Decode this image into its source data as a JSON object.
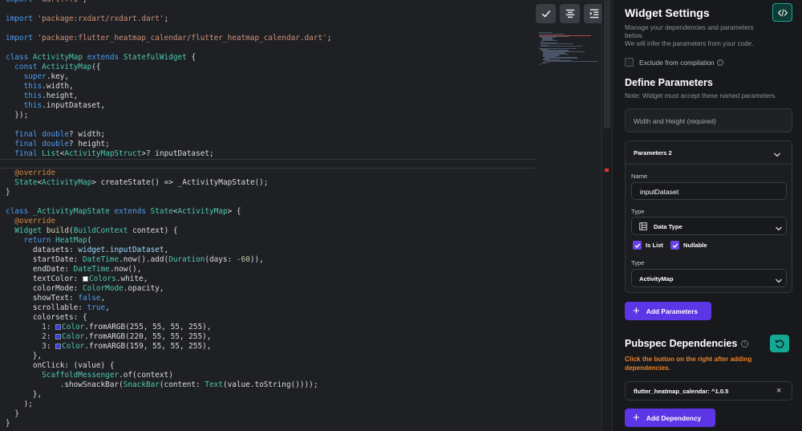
{
  "editor": {
    "lines": [
      [
        [
          "kw",
          "import "
        ],
        [
          "str",
          "'dart:ffi'"
        ],
        [
          "pl",
          ";"
        ]
      ],
      [],
      [
        [
          "kw",
          "import "
        ],
        [
          "str",
          "'package:rxdart/rxdart.dart'"
        ],
        [
          "pl",
          ";"
        ]
      ],
      [],
      [
        [
          "kw",
          "import "
        ],
        [
          "str",
          "'package:flutter_heatmap_calendar/flutter_heatmap_calendar.dart'"
        ],
        [
          "pl",
          ";"
        ]
      ],
      [],
      [
        [
          "kw",
          "class "
        ],
        [
          "ty",
          "ActivityMap "
        ],
        [
          "kw",
          "extends "
        ],
        [
          "ty",
          "StatefulWidget"
        ],
        [
          "pl",
          " {"
        ]
      ],
      [
        [
          "kw",
          "  const "
        ],
        [
          "ty",
          "ActivityMap"
        ],
        [
          "pl",
          "({"
        ]
      ],
      [
        [
          "kw",
          "    super"
        ],
        [
          "pl",
          ".key,"
        ]
      ],
      [
        [
          "kw",
          "    this"
        ],
        [
          "pl",
          ".width,"
        ]
      ],
      [
        [
          "kw",
          "    this"
        ],
        [
          "pl",
          ".height,"
        ]
      ],
      [
        [
          "kw",
          "    this"
        ],
        [
          "pl",
          ".inputDataset,"
        ]
      ],
      [
        [
          "pl",
          "  });"
        ]
      ],
      [],
      [
        [
          "kw",
          "  final "
        ],
        [
          "kw",
          "double"
        ],
        [
          "pl",
          "? width;"
        ]
      ],
      [
        [
          "kw",
          "  final "
        ],
        [
          "kw",
          "double"
        ],
        [
          "pl",
          "? height;"
        ]
      ],
      [
        [
          "kw",
          "  final "
        ],
        [
          "ty",
          "List"
        ],
        [
          "pl",
          "<"
        ],
        [
          "ty",
          "ActivityMapStruct"
        ],
        [
          "pl",
          ">? inputDataset;"
        ]
      ],
      [],
      [
        [
          "an",
          "  @override"
        ]
      ],
      [
        [
          "ty",
          "  State"
        ],
        [
          "pl",
          "<"
        ],
        [
          "ty",
          "ActivityMap"
        ],
        [
          "pl",
          "> createState() => _ActivityMapState();"
        ]
      ],
      [
        [
          "pl",
          "}"
        ]
      ],
      [],
      [
        [
          "kw",
          "class "
        ],
        [
          "ty",
          "_ActivityMapState "
        ],
        [
          "kw",
          "extends "
        ],
        [
          "ty",
          "State"
        ],
        [
          "pl",
          "<"
        ],
        [
          "ty",
          "ActivityMap"
        ],
        [
          "pl",
          "> {"
        ]
      ],
      [
        [
          "an",
          "  @override"
        ]
      ],
      [
        [
          "ty",
          "  Widget "
        ],
        [
          "fn",
          "build"
        ],
        [
          "pl",
          "("
        ],
        [
          "ty",
          "BuildContext"
        ],
        [
          "pl",
          " context) {"
        ]
      ],
      [
        [
          "kw",
          "    return "
        ],
        [
          "ty",
          "HeatMap"
        ],
        [
          "pl",
          "("
        ]
      ],
      [
        [
          "pl",
          "      datasets: "
        ],
        [
          "id",
          "widget.inputDataset"
        ],
        [
          "pl",
          ","
        ]
      ],
      [
        [
          "pl",
          "      startDate: "
        ],
        [
          "ty",
          "DateTime"
        ],
        [
          "pl",
          ".now().add("
        ],
        [
          "ty",
          "Duration"
        ],
        [
          "pl",
          "(days: "
        ],
        [
          "num",
          "-60"
        ],
        [
          "pl",
          ")),"
        ]
      ],
      [
        [
          "pl",
          "      endDate: "
        ],
        [
          "ty",
          "DateTime"
        ],
        [
          "pl",
          ".now(),"
        ]
      ],
      [
        [
          "pl",
          "      textColor: "
        ],
        [
          "sw",
          "#ffffff"
        ],
        [
          "ty",
          "Colors"
        ],
        [
          "pl",
          ".white,"
        ]
      ],
      [
        [
          "pl",
          "      colorMode: "
        ],
        [
          "ty",
          "ColorMode"
        ],
        [
          "pl",
          ".opacity,"
        ]
      ],
      [
        [
          "pl",
          "      showText: "
        ],
        [
          "kw",
          "false"
        ],
        [
          "pl",
          ","
        ]
      ],
      [
        [
          "pl",
          "      scrollable: "
        ],
        [
          "kw",
          "true"
        ],
        [
          "pl",
          ","
        ]
      ],
      [
        [
          "pl",
          "      colorsets: {"
        ]
      ],
      [
        [
          "num",
          "        1"
        ],
        [
          "pl",
          ": "
        ],
        [
          "sw",
          "#3737ff"
        ],
        [
          "ty",
          "Color"
        ],
        [
          "pl",
          ".fromARGB(255, 55, 55, 255),"
        ]
      ],
      [
        [
          "num",
          "        2"
        ],
        [
          "pl",
          ": "
        ],
        [
          "sw",
          "#3737ff"
        ],
        [
          "ty",
          "Color"
        ],
        [
          "pl",
          ".fromARGB(220, 55, 55, 255),"
        ]
      ],
      [
        [
          "num",
          "        3"
        ],
        [
          "pl",
          ": "
        ],
        [
          "sw",
          "#3737ff"
        ],
        [
          "ty",
          "Color"
        ],
        [
          "pl",
          ".fromARGB(159, 55, 55, 255),"
        ]
      ],
      [
        [
          "pl",
          "      },"
        ]
      ],
      [
        [
          "pl",
          "      onClick: (value) {"
        ]
      ],
      [
        [
          "ty",
          "        ScaffoldMessenger"
        ],
        [
          "pl",
          ".of(context)"
        ]
      ],
      [
        [
          "pl",
          "            .showSnackBar("
        ],
        [
          "ty",
          "SnackBar"
        ],
        [
          "pl",
          "(content: "
        ],
        [
          "ty",
          "Text"
        ],
        [
          "pl",
          "(value.toString())));"
        ]
      ],
      [
        [
          "pl",
          "      },"
        ]
      ],
      [
        [
          "pl",
          "    );"
        ]
      ],
      [
        [
          "pl",
          "  }"
        ]
      ],
      [
        [
          "pl",
          "}"
        ]
      ]
    ]
  },
  "panel": {
    "title": "Widget Settings",
    "subtitle_lines": [
      "Manage your dependencies and parameters",
      "below.",
      "We will infer the parameters from your code."
    ],
    "exclude_label": "Exclude from compilation",
    "define_title": "Define Parameters",
    "define_note": "Note: Widget must accept these named parameters.",
    "width_height_label": "Width and Height (required)",
    "params_card": {
      "header": "Parameters 2",
      "name_label": "Name",
      "name_value": "inputDataset",
      "type_label": "Type",
      "type_value": "Data Type",
      "is_list_label": "Is List",
      "nullable_label": "Nullable",
      "type2_label": "Type",
      "type2_value": "ActivityMap"
    },
    "add_params_label": "Add Parameters",
    "pubspec_title": "Pubspec Dependencies",
    "pubspec_note_lines": [
      "Click the button on the right after adding",
      "dependencies."
    ],
    "dependency_value": "flutter_heatmap_calendar: ^1.0.5",
    "add_dependency_label": "Add Dependency"
  },
  "colors": {
    "accent_purple": "#5c35e6",
    "accent_teal": "#19a595",
    "warning_orange": "#e8822a"
  }
}
